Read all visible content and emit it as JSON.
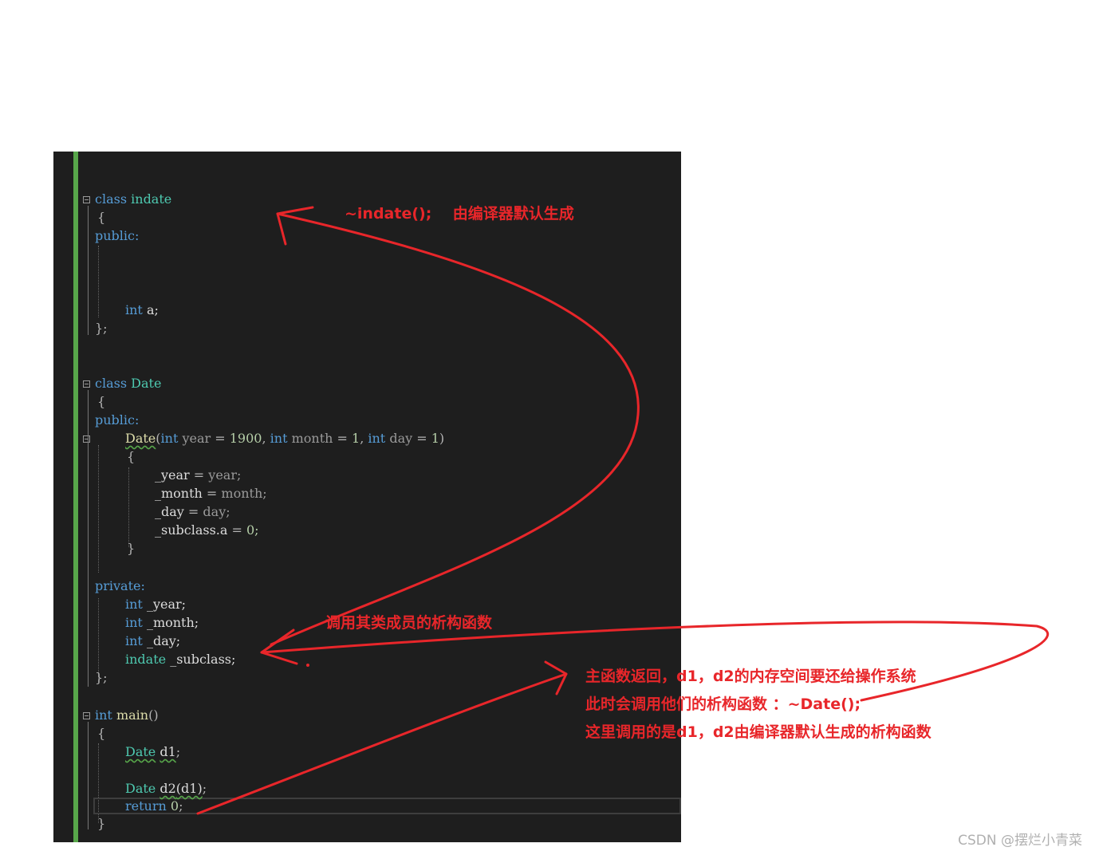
{
  "code": {
    "indate_class": {
      "kw_class": "class",
      "name": "indate",
      "open_brace": "{",
      "access": "public:",
      "member_type": "int",
      "member_name": "a;",
      "close_brace": "};"
    },
    "date_class": {
      "kw_class": "class",
      "name": "Date",
      "open_brace": "{",
      "access": "public:",
      "ctor": {
        "name": "Date",
        "open": "(",
        "t1": "int",
        "p1": "year",
        "eq1": " = ",
        "v1": "1900",
        "sep1": ", ",
        "t2": "int",
        "p2": "month",
        "eq2": " = ",
        "v2": "1",
        "sep2": ", ",
        "t3": "int",
        "p3": "day",
        "eq3": " = ",
        "v3": "1",
        "close": ")"
      },
      "ctor_open": "{",
      "body": [
        {
          "lhs": "_year",
          "op": " = ",
          "rhs": "year;"
        },
        {
          "lhs": "_month",
          "op": " = ",
          "rhs": "month;"
        },
        {
          "lhs": "_day",
          "op": " = ",
          "rhs": "day;"
        },
        {
          "lhs": "_subclass.a",
          "op": " = ",
          "rhs": "0;"
        }
      ],
      "ctor_close": "}",
      "private": "private:",
      "fields": [
        {
          "type": "int",
          "name": " _year;"
        },
        {
          "type": "int",
          "name": " _month;"
        },
        {
          "type": "int",
          "name": " _day;"
        },
        {
          "type": "indate",
          "name": " _subclass;"
        }
      ],
      "close_brace": "};"
    },
    "main_fn": {
      "ret_type": "int",
      "name": "main",
      "parens": "()",
      "open_brace": "{",
      "decl1_type": "Date",
      "decl1_var": "d1",
      "decl1_end": ";",
      "decl2_type": "Date",
      "decl2_var": "d2",
      "decl2_args": "(d1)",
      "decl2_end": ";",
      "ret_kw": "return",
      "ret_val": "0",
      "ret_end": ";",
      "close_brace": "}"
    }
  },
  "annotations": {
    "top": "~indate();    由编译器默认生成",
    "middle": "调用其类成员的析构函数",
    "bottom_lines": [
      "主函数返回，d1，d2的内存空间要还给操作系统",
      "此时会调用他们的析构函数 ：~Date();",
      "这里调用的是d1，d2由编译器默认生成的析构函数"
    ]
  },
  "colors": {
    "accent": "#e8262a",
    "editor_bg": "#1e1e1e",
    "keyword": "#569cd6",
    "type": "#4ec9b0",
    "gutter": "#57a64a"
  },
  "watermark": "CSDN @摆烂小青菜"
}
